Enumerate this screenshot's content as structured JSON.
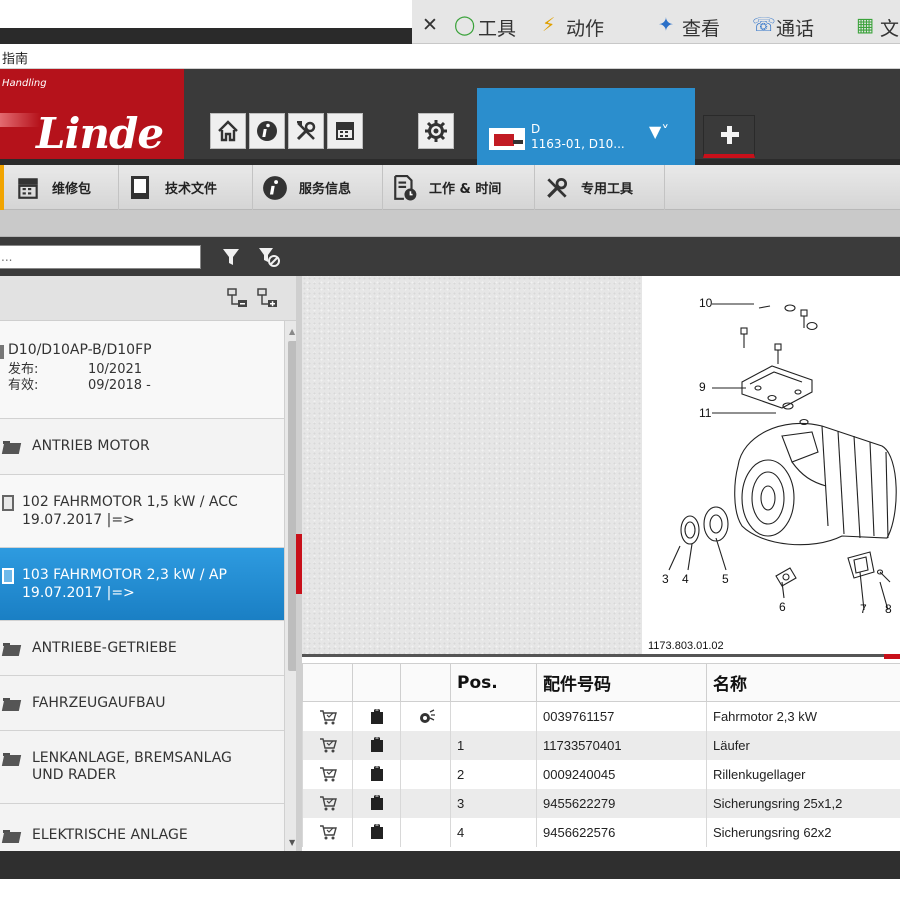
{
  "external_toolbar": {
    "items": [
      "工具",
      "动作",
      "查看",
      "通话",
      "文"
    ]
  },
  "window": {
    "title": "指南"
  },
  "logo": {
    "tagline": "Handling",
    "wordmark": "Linde"
  },
  "vehicle_tab": {
    "line1": "D",
    "line2": "1163-01, D10..."
  },
  "toolbar": {
    "items": [
      {
        "label": "维修包",
        "icon": "repair-kit-icon"
      },
      {
        "label": "技术文件",
        "icon": "technical-document-icon"
      },
      {
        "label": "服务信息",
        "icon": "info-icon"
      },
      {
        "label": "工作 & 时间",
        "icon": "work-time-icon"
      },
      {
        "label": "专用工具",
        "icon": "special-tools-icon"
      }
    ]
  },
  "search": {
    "placeholder": "..."
  },
  "tree": {
    "header": {
      "model": "D10/D10AP-B/D10FP",
      "release_label": "发布:",
      "release_value": "10/2021",
      "valid_label": "有效:",
      "valid_value": "09/2018 -"
    },
    "items": [
      {
        "line1": "ANTRIEB MOTOR",
        "line2": "",
        "icon": "folder-icon"
      },
      {
        "line1": "102 FAHRMOTOR 1,5 kW / ACC",
        "line2": "19.07.2017 |=>",
        "icon": "document-icon"
      },
      {
        "line1": "103 FAHRMOTOR 2,3 kW / AP",
        "line2": "19.07.2017 |=>",
        "icon": "document-icon",
        "selected": true
      },
      {
        "line1": "ANTRIEBE-GETRIEBE",
        "line2": "",
        "icon": "folder-icon"
      },
      {
        "line1": "FAHRZEUGAUFBAU",
        "line2": "",
        "icon": "folder-icon"
      },
      {
        "line1": "LENKANLAGE, BREMSANLAG",
        "line2": "UND RADER",
        "icon": "folder-icon"
      },
      {
        "line1": "ELEKTRISCHE ANLAGE",
        "line2": "",
        "icon": "folder-icon"
      }
    ]
  },
  "drawing": {
    "callouts": [
      "10",
      "9",
      "11",
      "3",
      "4",
      "5",
      "6",
      "7",
      "8"
    ],
    "reference": "1173.803.01.02"
  },
  "parts_table": {
    "headers": [
      "",
      "",
      "",
      "Pos.",
      "配件号码",
      "名称"
    ],
    "rows": [
      {
        "pos": "",
        "part_no": "0039761157",
        "name": "Fahrmotor 2,3 kW",
        "has_detail_icon": true
      },
      {
        "pos": "1",
        "part_no": "11733570401",
        "name": "Läufer",
        "has_detail_icon": false
      },
      {
        "pos": "2",
        "part_no": "0009240045",
        "name": "Rillenkugellager",
        "has_detail_icon": false
      },
      {
        "pos": "3",
        "part_no": "9455622279",
        "name": "Sicherungsring 25x1,2",
        "has_detail_icon": false
      },
      {
        "pos": "4",
        "part_no": "9456622576",
        "name": "Sicherungsring 62x2",
        "has_detail_icon": false
      }
    ]
  },
  "colors": {
    "brand_red": "#b5121b",
    "tab_blue": "#2b8ecd",
    "selected_blue": "#1a7fc4",
    "header_dark": "#3a3a3a"
  }
}
